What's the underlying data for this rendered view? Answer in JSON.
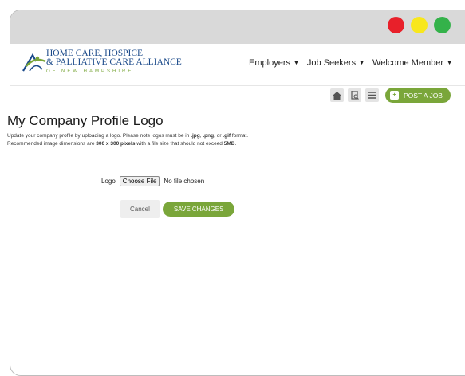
{
  "brand": {
    "line1": "HOME CARE, HOSPICE",
    "line2": "& PALLIATIVE CARE ALLIANCE",
    "line3": "OF NEW HAMPSHIRE",
    "colors": {
      "blue": "#1b4a8a",
      "green": "#7aa63a"
    }
  },
  "window_controls": {
    "red": "#e8202a",
    "yellow": "#f8e71c",
    "green": "#34b24a"
  },
  "nav": {
    "items": [
      {
        "label": "Employers"
      },
      {
        "label": "Job Seekers"
      },
      {
        "label": "Welcome Member"
      }
    ]
  },
  "toolbar": {
    "icons": [
      "home-icon",
      "search-document-icon",
      "list-icon"
    ],
    "post_job_label": "POST A JOB"
  },
  "page": {
    "title": "My Company Profile Logo",
    "desc_line1_a": "Update your company profile by uploading a logo. Please note logos must be in ",
    "desc_line1_b": ".jpg",
    "desc_line1_c": ", ",
    "desc_line1_d": ".png",
    "desc_line1_e": ", or ",
    "desc_line1_f": ".gif",
    "desc_line1_g": " format.",
    "desc_line2_a": "Recommended image dimensions are ",
    "desc_line2_b": "300 x 300 pixels",
    "desc_line2_c": " with a file size that should not exceed ",
    "desc_line2_d": "5MB",
    "desc_line2_e": "."
  },
  "form": {
    "logo_label": "Logo",
    "choose_file_label": "Choose File",
    "no_file_text": "No file chosen",
    "cancel_label": "Cancel",
    "save_label": "SAVE CHANGES"
  }
}
